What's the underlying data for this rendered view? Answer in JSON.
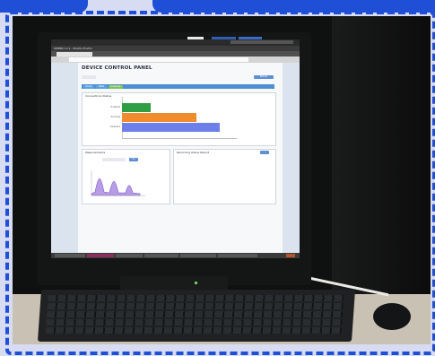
{
  "scene": {
    "description_tag": "photo of a computer monitor on a desk",
    "frame_color": "#1f4fd6"
  },
  "screen": {
    "browser_title": "WEBBS 12.1 - Mozilla Firefox",
    "panel_title": "DEVICE CONTROL PANEL",
    "top_right_button": "Refresh",
    "nav_items": [
      "Home",
      "Stats",
      "Overview"
    ],
    "chart_section_label": "Connections Status",
    "bars": [
      {
        "label": "Enabled",
        "value": 0.25,
        "color": "#2f9e44"
      },
      {
        "label": "Pending",
        "value": 0.65,
        "color": "#f08c2e"
      },
      {
        "label": "Disabled",
        "value": 0.85,
        "color": "#6d7fe8"
      }
    ],
    "measurements_title": "Measurements",
    "recording_title": "Recording status Report",
    "go_button": "Go"
  },
  "colors": {
    "accent": "#5d8fd6",
    "nav": "#4d8fd0"
  }
}
